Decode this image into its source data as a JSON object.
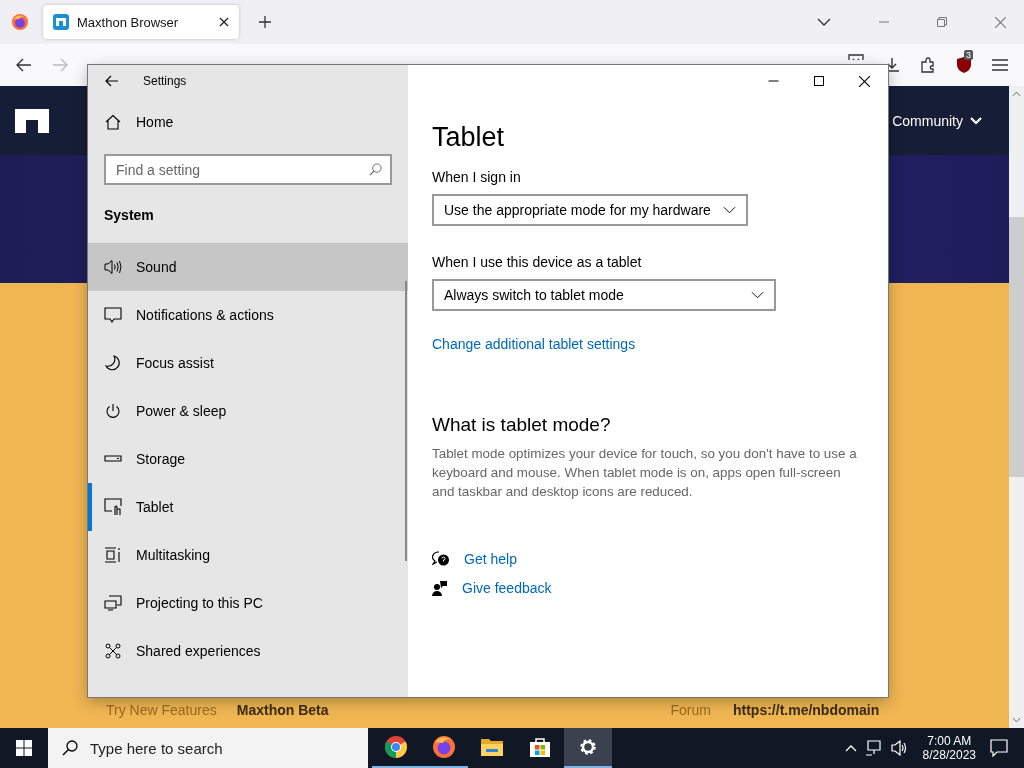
{
  "browser": {
    "tabs": [
      {
        "title": "Maxthon Browser",
        "selected": true
      }
    ],
    "extension_badge": "3"
  },
  "page": {
    "nav": [
      {
        "label": "Community"
      }
    ],
    "footer": [
      {
        "text": "Try New Features",
        "kind": "muted"
      },
      {
        "text": "Maxthon Beta",
        "kind": "strong"
      },
      {
        "text": "Forum",
        "kind": "muted"
      },
      {
        "text": "https://t.me/nbdomain",
        "kind": "strong"
      }
    ]
  },
  "settings": {
    "title": "Settings",
    "home": "Home",
    "search_placeholder": "Find a setting",
    "section": "System",
    "items": [
      {
        "label": "Sound",
        "kind": "sound",
        "hovered": true,
        "selected": false
      },
      {
        "label": "Notifications & actions",
        "kind": "notifications",
        "hovered": false,
        "selected": false
      },
      {
        "label": "Focus assist",
        "kind": "moon",
        "hovered": false,
        "selected": false
      },
      {
        "label": "Power & sleep",
        "kind": "power",
        "hovered": false,
        "selected": false
      },
      {
        "label": "Storage",
        "kind": "storage",
        "hovered": false,
        "selected": false
      },
      {
        "label": "Tablet",
        "kind": "tablet",
        "hovered": false,
        "selected": true
      },
      {
        "label": "Multitasking",
        "kind": "multitasking",
        "hovered": false,
        "selected": false
      },
      {
        "label": "Projecting to this PC",
        "kind": "projecting",
        "hovered": false,
        "selected": false
      },
      {
        "label": "Shared experiences",
        "kind": "shared",
        "hovered": false,
        "selected": false
      }
    ],
    "heading": "Tablet",
    "fields": [
      {
        "label": "When I sign in",
        "value": "Use the appropriate mode for my hardware"
      },
      {
        "label": "When I use this device as a tablet",
        "value": "Always switch to tablet mode"
      }
    ],
    "link": "Change additional tablet settings",
    "subheading": "What is tablet mode?",
    "description": "Tablet mode optimizes your device for touch, so you don't have to use a keyboard and mouse. When tablet mode is on, apps open full-screen and taskbar and desktop icons are reduced.",
    "help_links": [
      {
        "label": "Get help",
        "kind": "help"
      },
      {
        "label": "Give feedback",
        "kind": "feedback"
      }
    ]
  },
  "taskbar": {
    "search_placeholder": "Type here to search",
    "apps": [
      {
        "kind": "chrome",
        "running": true,
        "selected": false
      },
      {
        "kind": "firefox",
        "running": true,
        "selected": false
      },
      {
        "kind": "folder",
        "running": false,
        "selected": false
      },
      {
        "kind": "store",
        "running": false,
        "selected": false
      },
      {
        "kind": "settings",
        "running": true,
        "selected": true
      }
    ],
    "time": "7:00 AM",
    "date": "8/28/2023"
  }
}
